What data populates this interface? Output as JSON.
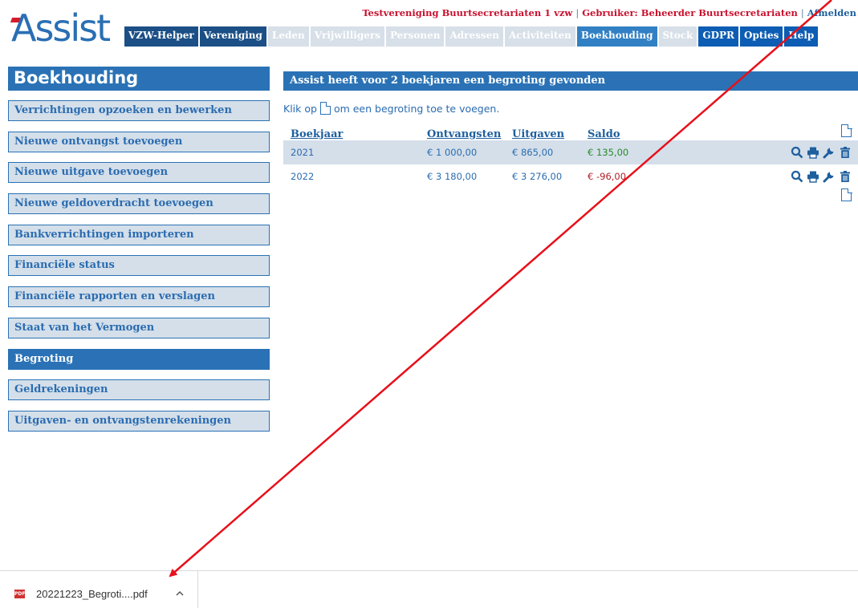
{
  "header": {
    "org": "Testvereniging Buurtsecretariaten 1 vzw",
    "user": "Gebruiker: Beheerder Buurtsecretariaten",
    "logout": "Afmelden",
    "logo": "Assist",
    "nav": [
      {
        "label": "VZW-Helper",
        "style": "dark"
      },
      {
        "label": "Vereniging",
        "style": "dark"
      },
      {
        "label": "Leden",
        "style": "light"
      },
      {
        "label": "Vrijwilligers",
        "style": "light"
      },
      {
        "label": "Personen",
        "style": "light"
      },
      {
        "label": "Adressen",
        "style": "light"
      },
      {
        "label": "Activiteiten",
        "style": "light"
      },
      {
        "label": "Boekhouding",
        "style": "active"
      },
      {
        "label": "Stock",
        "style": "light"
      },
      {
        "label": "GDPR",
        "style": "navy"
      },
      {
        "label": "Opties",
        "style": "navy"
      },
      {
        "label": "Help",
        "style": "navy"
      }
    ]
  },
  "sidebar": {
    "title": "Boekhouding",
    "items": [
      {
        "label": "Verrichtingen opzoeken en bewerken",
        "active": false
      },
      {
        "label": "Nieuwe ontvangst toevoegen",
        "active": false
      },
      {
        "label": "Nieuwe uitgave toevoegen",
        "active": false
      },
      {
        "label": "Nieuwe geldoverdracht toevoegen",
        "active": false
      },
      {
        "label": "Bankverrichtingen importeren",
        "active": false
      },
      {
        "label": "Financiële status",
        "active": false
      },
      {
        "label": "Financiële rapporten en verslagen",
        "active": false
      },
      {
        "label": "Staat van het Vermogen",
        "active": false
      },
      {
        "label": "Begroting",
        "active": true
      },
      {
        "label": "Geldrekeningen",
        "active": false
      },
      {
        "label": "Uitgaven- en ontvangstenrekeningen",
        "active": false
      }
    ]
  },
  "main": {
    "heading": "Assist heeft voor 2 boekjaren een begroting gevonden",
    "hint_before": "Klik op",
    "hint_after": "om een begroting toe te voegen.",
    "columns": {
      "year": "Boekjaar",
      "income": "Ontvangsten",
      "expenses": "Uitgaven",
      "balance": "Saldo"
    },
    "rows": [
      {
        "year": "2021",
        "income": "€ 1 000,00",
        "expenses": "€ 865,00",
        "balance": "€ 135,00",
        "balance_sign": "pos"
      },
      {
        "year": "2022",
        "income": "€ 3 180,00",
        "expenses": "€ 3 276,00",
        "balance": "€ -96,00",
        "balance_sign": "neg"
      }
    ],
    "action_icons": [
      "search-icon",
      "print-icon",
      "wrench-icon",
      "trash-icon"
    ]
  },
  "downloads": {
    "file_name": "20221223_Begroti....pdf",
    "file_badge": "PDF"
  },
  "colors": {
    "brand_blue": "#2a72b5",
    "nav_dark": "#1b4f86",
    "accent_red": "#c8102e",
    "positive": "#2a8a2a",
    "negative": "#b0202a",
    "annotation_arrow": "#e8101a"
  }
}
